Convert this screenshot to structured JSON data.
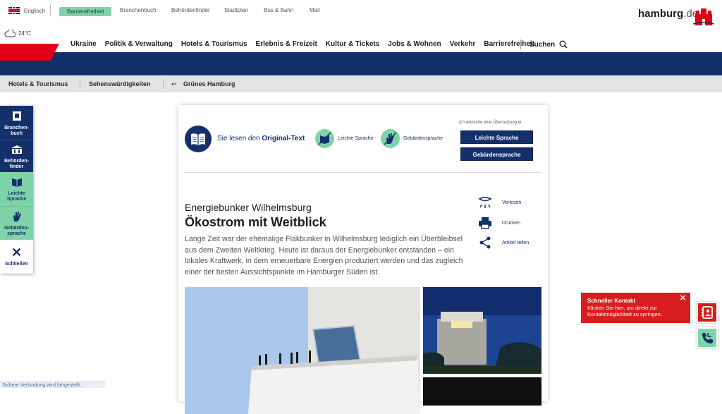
{
  "topbar": {
    "language": "Englisch",
    "links": [
      "Barrierefreiheit",
      "Branchenbuch",
      "Behördenfinder",
      "Stadtplan",
      "Bus & Bahn",
      "Mail"
    ]
  },
  "logo": {
    "name": "hamburg",
    "tld": ".de"
  },
  "weather": {
    "temp": "24°C"
  },
  "mainnav": {
    "items": [
      "Ukraine",
      "Politik & Verwaltung",
      "Hotels & Tourismus",
      "Erlebnis & Freizeit",
      "Kultur & Tickets",
      "Jobs & Wohnen",
      "Verkehr",
      "Barrierefreiheit"
    ],
    "search": "Suchen"
  },
  "breadcrumb": {
    "items": [
      "Hotels & Tourismus",
      "Sehenswürdigkeiten",
      "Grünes Hamburg"
    ]
  },
  "rail": {
    "items": [
      {
        "label": "Branchen-\nbuch"
      },
      {
        "label": "Behörden-\nfinder"
      },
      {
        "label": "Leichte\nSprache"
      },
      {
        "label": "Gebärden-\nsprache"
      },
      {
        "label": "Schließen"
      }
    ]
  },
  "translation": {
    "reading_prefix": "Sie lesen den",
    "reading_bold": "Original-Text",
    "option_easy": "Leichte Sprache",
    "option_sign": "Gebärdensprache",
    "wish": "Ich wünsche eine Übersetzung in:",
    "btn_easy": "Leichte Sprache",
    "btn_sign": "Gebärdensprache"
  },
  "article": {
    "subtitle": "Energiebunker Wilhelmsburg",
    "title": "Ökostrom mit Weitblick",
    "lead": "Lange Zeit war der ehemalige Flakbunker in Wilhelmsburg lediglich ein Überbleibsel aus dem Zweiten Weltkrieg. Heute ist daraus der Energiebunker entstanden – ein lokales Kraftwerk, in dem erneuerbare Energien produziert werden und das zugleich einer der besten Aussichtspunkte im Hamburger Süden ist."
  },
  "actions": {
    "read": "Vorlesen",
    "print": "Drucken",
    "share": "Artikel teilen"
  },
  "quick": {
    "title": "Schneller Kontakt",
    "text": "Klicken Sie hier, um direkt zur Kontaktmöglichkeit zu springen."
  },
  "status": {
    "text": "Sichere Verbindung wird hergestellt..."
  },
  "colors": {
    "navy": "#13306b",
    "red": "#e10019",
    "mint": "#7fd3a8"
  }
}
